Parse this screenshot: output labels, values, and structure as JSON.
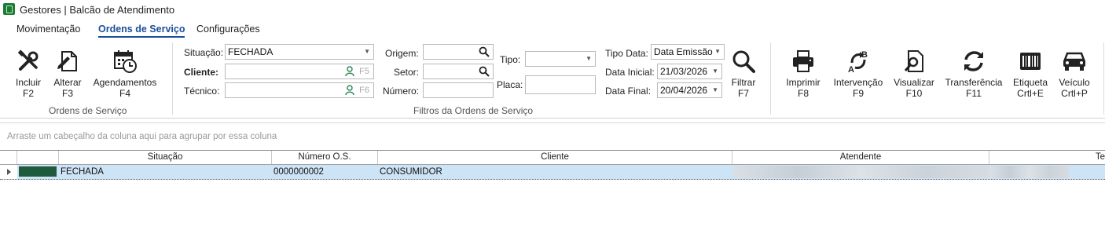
{
  "window": {
    "title": "Gestores |  Balcão de Atendimento"
  },
  "menu": {
    "tabs": [
      {
        "label": "Movimentação"
      },
      {
        "label": "Ordens de Serviço"
      },
      {
        "label": "Configurações"
      }
    ],
    "active_tab": "Ordens de Serviço"
  },
  "ribbon": {
    "os_group": {
      "label": "Ordens de Serviço",
      "buttons": [
        {
          "label": "Incluir",
          "key": "F2",
          "icon": "tools-icon"
        },
        {
          "label": "Alterar",
          "key": "F3",
          "icon": "edit-document-icon"
        },
        {
          "label": "Agendamentos",
          "key": "F4",
          "icon": "calendar-clock-icon"
        }
      ]
    },
    "filters_group": {
      "label": "Filtros da Ordens de Serviço",
      "situacao": {
        "label": "Situação:",
        "value": "FECHADA"
      },
      "cliente": {
        "label": "Cliente:",
        "shortcut": "F5",
        "value": ""
      },
      "tecnico": {
        "label": "Técnico:",
        "shortcut": "F6",
        "value": ""
      },
      "origem": {
        "label": "Origem:",
        "value": ""
      },
      "setor": {
        "label": "Setor:",
        "value": ""
      },
      "numero": {
        "label": "Número:",
        "value": ""
      },
      "tipo": {
        "label": "Tipo:",
        "value": ""
      },
      "placa": {
        "label": "Placa:",
        "value": ""
      },
      "tipo_data": {
        "label": "Tipo Data:",
        "value": "Data Emissão"
      },
      "data_inicial": {
        "label": "Data Inicial:",
        "value": "21/03/2026"
      },
      "data_final": {
        "label": "Data Final:",
        "value": "20/04/2026"
      },
      "filtrar": {
        "label": "Filtrar",
        "key": "F7",
        "icon": "search-icon"
      }
    },
    "actions": [
      {
        "label": "Imprimir",
        "key": "F8",
        "icon": "printer-icon"
      },
      {
        "label": "Intervenção",
        "key": "F9",
        "icon": "swap-ab-icon"
      },
      {
        "label": "Visualizar",
        "key": "F10",
        "icon": "preview-document-icon"
      },
      {
        "label": "Transferência",
        "key": "F11",
        "icon": "refresh-icon"
      },
      {
        "label": "Etiqueta",
        "key": "Crtl+E",
        "icon": "barcode-label-icon"
      },
      {
        "label": "Veículo",
        "key": "Crtl+P",
        "icon": "car-icon"
      }
    ]
  },
  "grid": {
    "group_hint": "Arraste um cabeçalho da coluna aqui para agrupar por essa coluna",
    "columns": [
      "Situação",
      "Número O.S.",
      "Cliente",
      "Atendente",
      "Te"
    ],
    "rows": [
      {
        "status_color": "#1e5a3d",
        "situacao": "FECHADA",
        "numero": "0000000002",
        "cliente": "CONSUMIDOR"
      }
    ]
  }
}
